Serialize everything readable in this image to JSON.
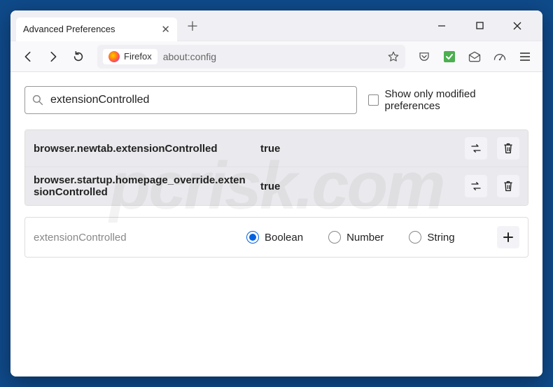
{
  "titlebar": {
    "tab_title": "Advanced Preferences"
  },
  "toolbar": {
    "brand_label": "Firefox",
    "url": "about:config"
  },
  "search": {
    "value": "extensionControlled",
    "modified_label": "Show only modified preferences"
  },
  "prefs": [
    {
      "name": "browser.newtab.extensionControlled",
      "value": "true"
    },
    {
      "name": "browser.startup.homepage_override.extensionControlled",
      "value": "true"
    }
  ],
  "newpref": {
    "name": "extensionControlled",
    "types": {
      "boolean": "Boolean",
      "number": "Number",
      "string": "String"
    }
  },
  "watermark": "pcrisk.com"
}
